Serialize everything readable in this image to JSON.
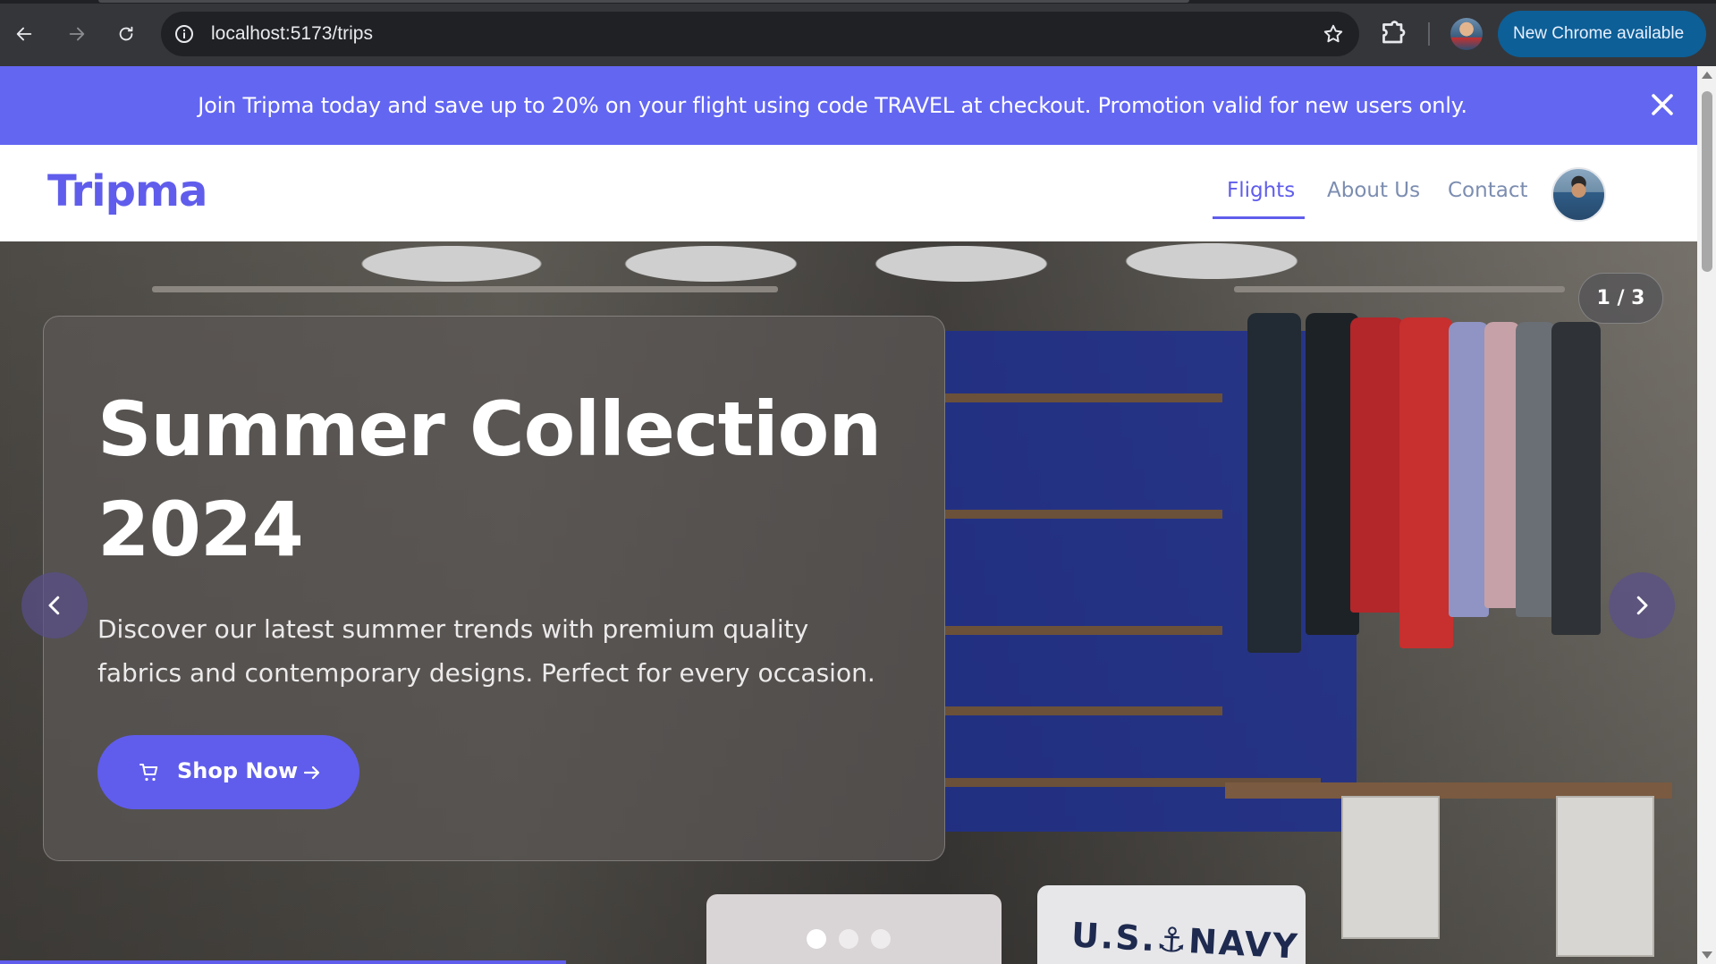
{
  "browser": {
    "url": "localhost:5173/trips",
    "update_label": "New Chrome available"
  },
  "promo": {
    "text": "Join Tripma today and save up to 20% on your flight using code TRAVEL at checkout. Promotion valid for new users only."
  },
  "header": {
    "logo": "Tripma",
    "nav": [
      {
        "label": "Flights",
        "active": true
      },
      {
        "label": "About Us",
        "active": false
      },
      {
        "label": "Contact",
        "active": false
      }
    ]
  },
  "hero": {
    "title_line1": "Summer Collection",
    "title_line2": "2024",
    "description": "Discover our latest summer trends with premium quality fabrics and contemporary designs. Perfect for every occasion.",
    "cta_label": "Shop Now",
    "slide_counter": "1 / 3",
    "current_slide": 1,
    "total_slides": 3,
    "scene_text": "U.S.⚓NAVY"
  },
  "colors": {
    "brand": "#605dec",
    "promo_bg": "#6366f1",
    "chrome_update": "#0d5f97"
  },
  "icons": [
    "back-arrow-icon",
    "forward-arrow-icon",
    "reload-icon",
    "site-info-icon",
    "bookmark-star-icon",
    "extensions-icon",
    "close-icon",
    "cart-icon",
    "arrow-right-icon",
    "chevron-left-icon",
    "chevron-right-icon"
  ]
}
